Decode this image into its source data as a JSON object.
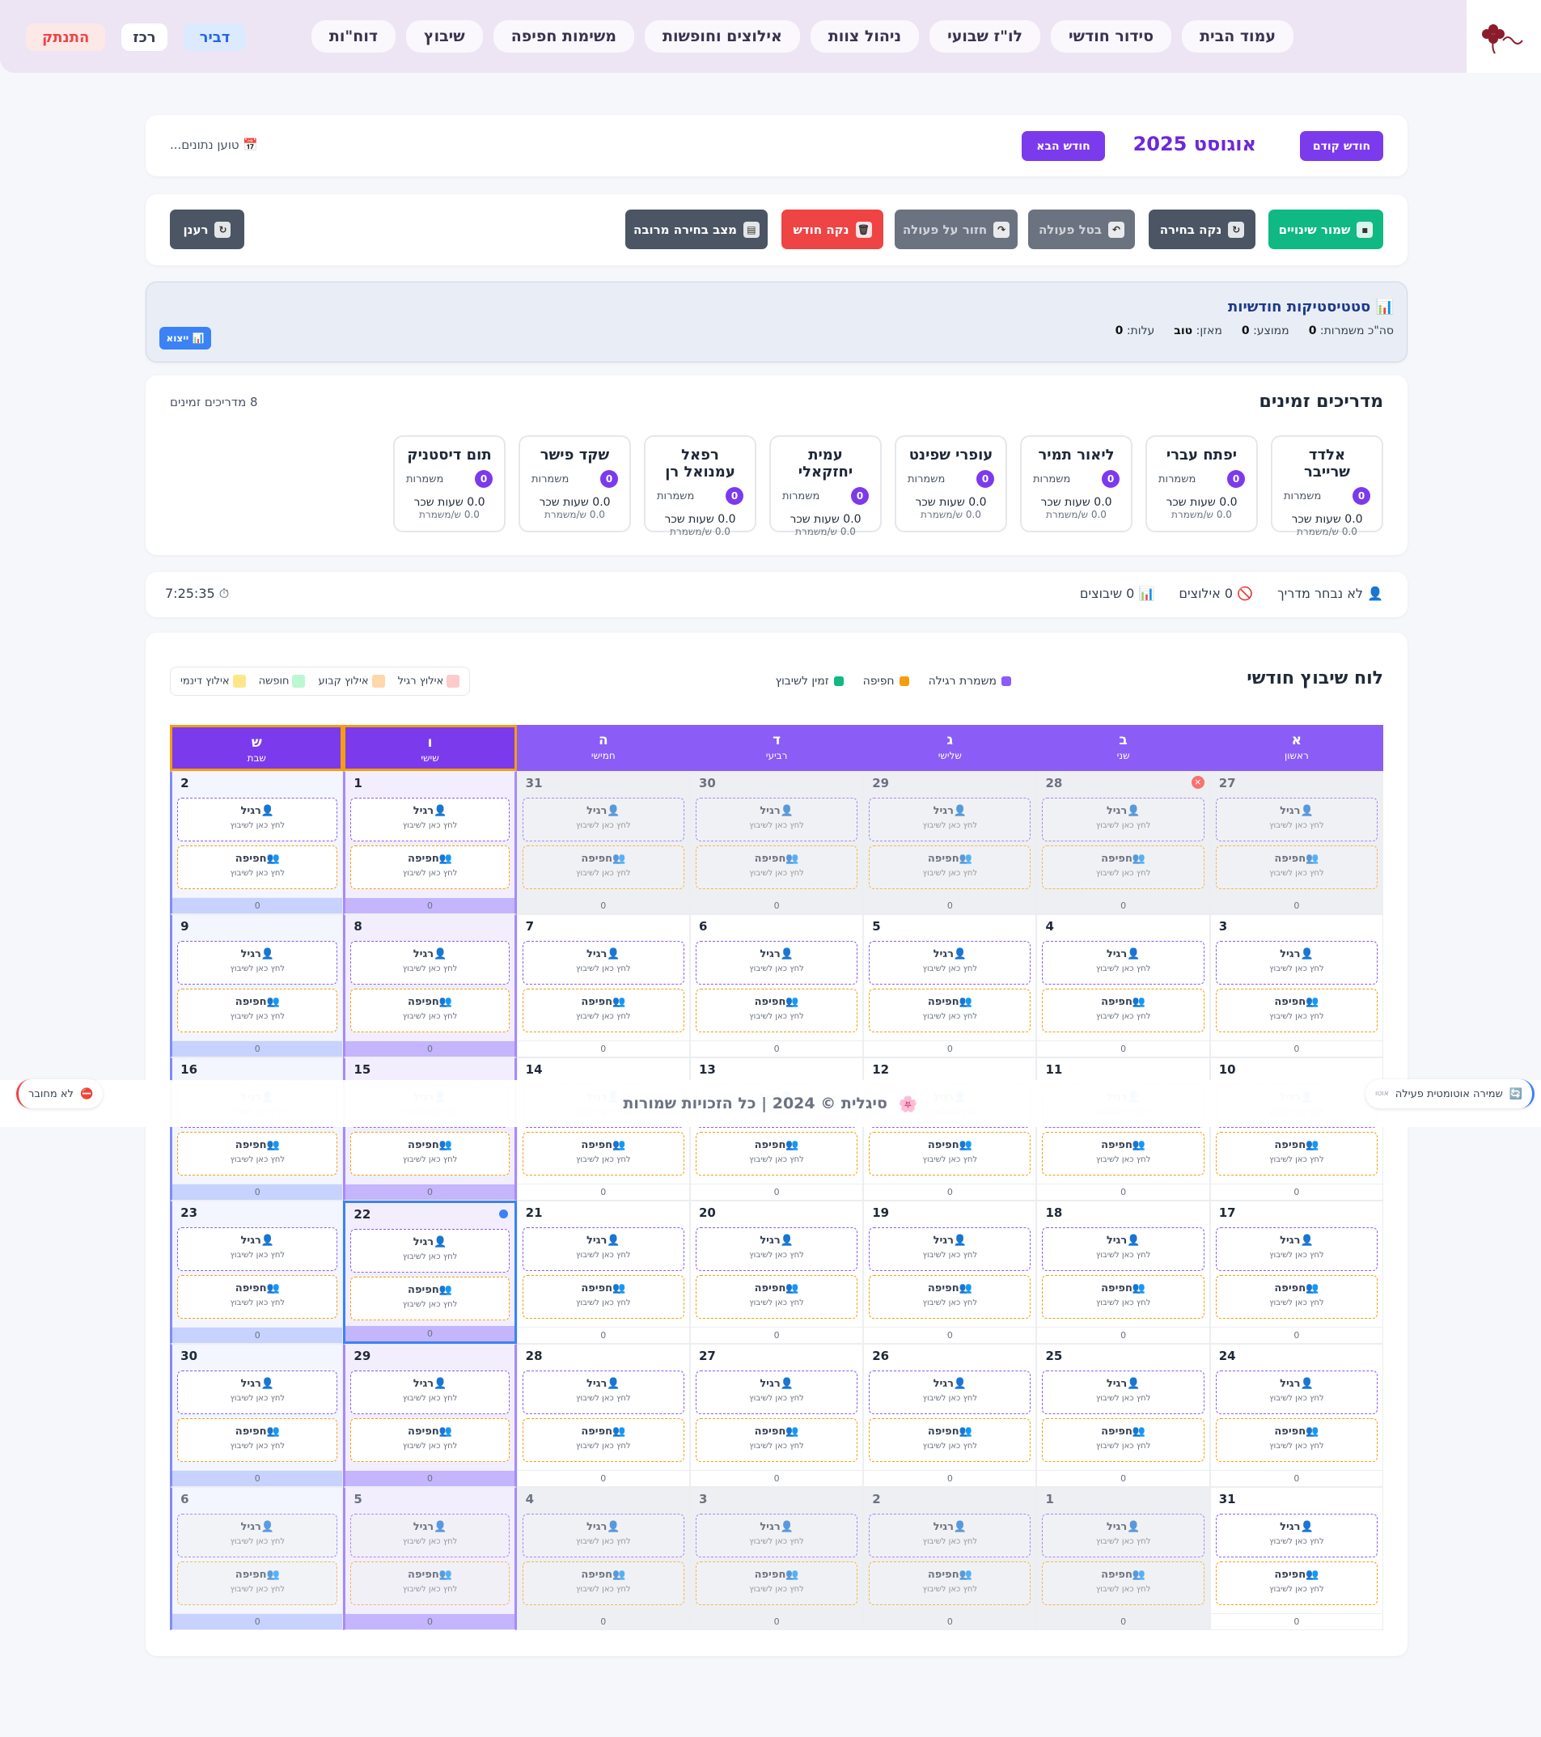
{
  "nav": {
    "tabs": [
      "עמוד הבית",
      "סידור חודשי",
      "לו\"ז שבועי",
      "ניהול צוות",
      "אילוצים וחופשות",
      "משימות חפיפה",
      "שיבוץ",
      "דוח\"ות"
    ],
    "user": {
      "name": "דביר",
      "role": "רכז",
      "logout": "התנתק"
    }
  },
  "month_header": {
    "prev": "חודש קודם",
    "title": "אוגוסט 2025",
    "next": "חודש הבא",
    "loading": "טוען נתונים..."
  },
  "toolbar": {
    "save": "שמור שינויים",
    "clear_selection": "נקה בחירה",
    "cancel": "בטל פעולה",
    "redo": "חזור על פעולה",
    "clear_month": "נקה חודש",
    "multi_select": "מצב בחירה מרובה",
    "refresh": "רענן"
  },
  "stats": {
    "title": "סטטיסטיקות חודשיות",
    "total_label": "סה\"כ משמרות:",
    "total": "0",
    "avg_label": "ממוצע:",
    "avg": "0",
    "balance_label": "מאזן:",
    "balance": "טוב",
    "cost_label": "עלות:",
    "cost": "0",
    "export": "ייצוא"
  },
  "guides": {
    "title": "מדריכים זמינים",
    "count": "8 מדריכים זמינים",
    "shifts_label": "משמרות",
    "list": [
      {
        "name": "אלדד שרייבר",
        "shifts": "0",
        "hours": "0.0 שעות שכר",
        "per": "0.0 ש/משמרת"
      },
      {
        "name": "יפתח עברי",
        "shifts": "0",
        "hours": "0.0 שעות שכר",
        "per": "0.0 ש/משמרת"
      },
      {
        "name": "ליאור תמיר",
        "shifts": "0",
        "hours": "0.0 שעות שכר",
        "per": "0.0 ש/משמרת"
      },
      {
        "name": "עופרי שפינט",
        "shifts": "0",
        "hours": "0.0 שעות שכר",
        "per": "0.0 ש/משמרת"
      },
      {
        "name": "עמית יחזקאלי",
        "shifts": "0",
        "hours": "0.0 שעות שכר",
        "per": "0.0 ש/משמרת"
      },
      {
        "name": "רפאל עמנואל רן",
        "shifts": "0",
        "hours": "0.0 שעות שכר",
        "per": "0.0 ש/משמרת"
      },
      {
        "name": "שקד פישר",
        "shifts": "0",
        "hours": "0.0 שעות שכר",
        "per": "0.0 ש/משמרת"
      },
      {
        "name": "תום דיסטניק",
        "shifts": "0",
        "hours": "0.0 שעות שכר",
        "per": "0.0 ש/משמרת"
      }
    ]
  },
  "status": {
    "guide": "לא נבחר מדריך",
    "constraints": "0 אילוצים",
    "assignments": "0 שיבוצים",
    "time": "7:25:35"
  },
  "calendar": {
    "title": "לוח שיבוץ חודשי",
    "legend": [
      "משמרת רגילה",
      "חפיפה",
      "זמין לשיבוץ"
    ],
    "legend2": [
      "אילוץ רגיל",
      "אילוץ קבוע",
      "חופשה",
      "אילוץ דינמי"
    ],
    "days": [
      {
        "letter": "א",
        "name": "ראשון"
      },
      {
        "letter": "ב",
        "name": "שני"
      },
      {
        "letter": "ג",
        "name": "שלישי"
      },
      {
        "letter": "ד",
        "name": "רביעי"
      },
      {
        "letter": "ה",
        "name": "חמישי"
      },
      {
        "letter": "ו",
        "name": "שישי"
      },
      {
        "letter": "ש",
        "name": "שבת"
      }
    ],
    "slot_regular": "רגיל",
    "slot_swap": "חפיפה",
    "slot_hint": "לחץ כאן לשיבוץ",
    "day_count": "0",
    "weeks": [
      [
        27,
        28,
        29,
        30,
        31,
        1,
        2
      ],
      [
        3,
        4,
        5,
        6,
        7,
        8,
        9
      ],
      [
        10,
        11,
        12,
        13,
        14,
        15,
        16
      ],
      [
        17,
        18,
        19,
        20,
        21,
        22,
        23
      ],
      [
        24,
        25,
        26,
        27,
        28,
        29,
        30
      ],
      [
        31,
        1,
        2,
        3,
        4,
        5,
        6
      ]
    ]
  },
  "footer": {
    "text": "סיגלית © 2024 | כל הזכויות שמורות",
    "connection": "לא מחובר",
    "autosave": "שמירה אוטומטית פעילה",
    "autosave_small": "אוטו"
  },
  "colors": {
    "brand": "#7c3aed",
    "regular": "#8b5cf6",
    "swap": "#f59e0b",
    "available": "#10b981",
    "danger": "#ef4444",
    "save": "#10b981"
  }
}
